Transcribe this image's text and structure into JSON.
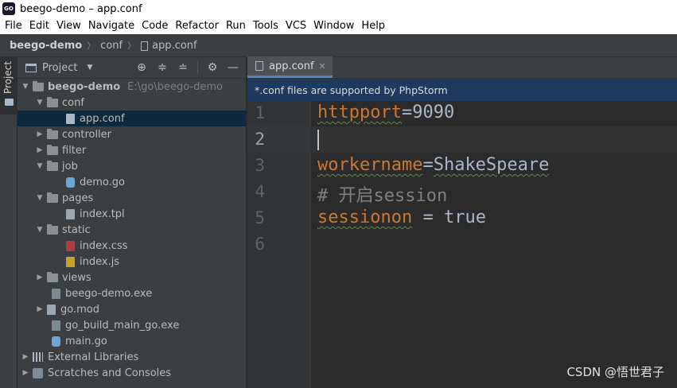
{
  "window": {
    "title": "beego-demo – app.conf",
    "app_icon_text": "GO"
  },
  "menu": [
    "File",
    "Edit",
    "View",
    "Navigate",
    "Code",
    "Refactor",
    "Run",
    "Tools",
    "VCS",
    "Window",
    "Help"
  ],
  "breadcrumb": {
    "project": "beego-demo",
    "folder": "conf",
    "file": "app.conf"
  },
  "toolstrip": {
    "label": "Project"
  },
  "project_panel": {
    "title": "Project",
    "tree": {
      "root": {
        "name": "beego-demo",
        "path": "E:\\go\\beego-demo"
      },
      "conf": {
        "name": "conf",
        "children": [
          "app.conf"
        ]
      },
      "controller": "controller",
      "filter": "filter",
      "job": {
        "name": "job",
        "children": [
          "demo.go"
        ]
      },
      "pages": {
        "name": "pages",
        "children": [
          "index.tpl"
        ]
      },
      "static": {
        "name": "static",
        "children": [
          "index.css",
          "index.js"
        ]
      },
      "views": "views",
      "files": [
        "beego-demo.exe",
        "go.mod",
        "go_build_main_go.exe",
        "main.go"
      ],
      "external_libraries": "External Libraries",
      "scratches": "Scratches and Consoles"
    }
  },
  "editor": {
    "tab": "app.conf",
    "banner": "*.conf files are supported by PhpStorm",
    "line_numbers": [
      "1",
      "2",
      "3",
      "4",
      "5",
      "6"
    ],
    "lines": {
      "l1_key": "httpport",
      "l1_eq": "=",
      "l1_val": "9090",
      "l3_key": "workername",
      "l3_eq": "=",
      "l3_val": "ShakeSpeare",
      "l4_comment": "# 开启session",
      "l5_key": "sessionon",
      "l5_eq": " = ",
      "l5_val": "true"
    },
    "current_line": 2
  },
  "watermark": "CSDN @悟世君子"
}
